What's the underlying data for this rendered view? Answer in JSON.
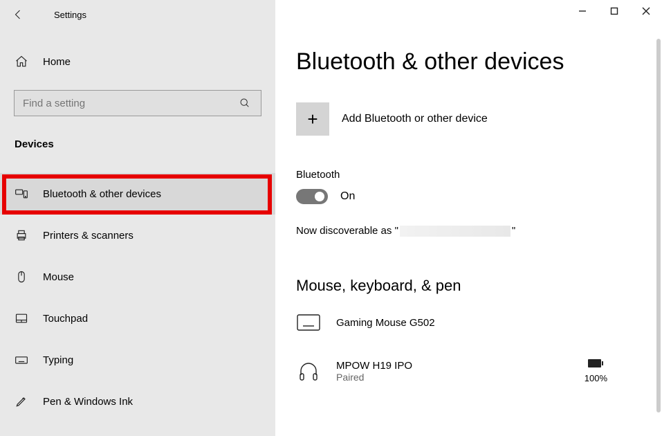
{
  "window": {
    "app_title": "Settings"
  },
  "sidebar": {
    "home_label": "Home",
    "search_placeholder": "Find a setting",
    "section_heading": "Devices",
    "items": [
      {
        "label": "Bluetooth & other devices"
      },
      {
        "label": "Printers & scanners"
      },
      {
        "label": "Mouse"
      },
      {
        "label": "Touchpad"
      },
      {
        "label": "Typing"
      },
      {
        "label": "Pen & Windows Ink"
      }
    ]
  },
  "main": {
    "page_title": "Bluetooth & other devices",
    "add_device_label": "Add Bluetooth or other device",
    "bluetooth_label": "Bluetooth",
    "bluetooth_state": "On",
    "discoverable_prefix": "Now discoverable as \"",
    "discoverable_suffix": "\"",
    "group_heading": "Mouse, keyboard, & pen",
    "devices": [
      {
        "name": "Gaming Mouse G502",
        "status": ""
      },
      {
        "name": "MPOW H19 IPO",
        "status": "Paired",
        "battery_pct": "100%"
      }
    ]
  }
}
